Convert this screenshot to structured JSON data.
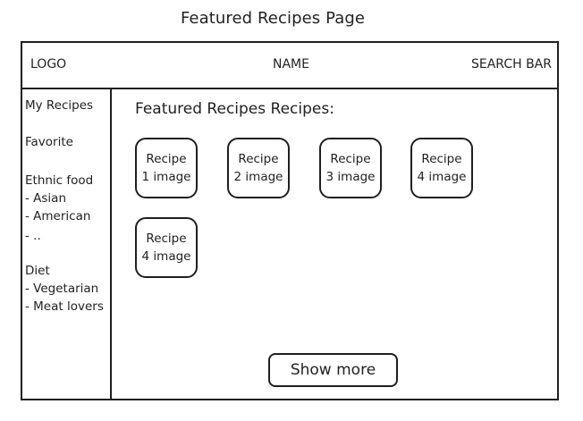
{
  "page_caption": "Featured Recipes Page",
  "header": {
    "logo": "LOGO",
    "name": "NAME",
    "search": "SEARCH BAR"
  },
  "sidebar": {
    "items": [
      "My Recipes",
      "Favorite",
      "Ethnic food",
      "- Asian",
      "- American",
      "- ..",
      "Diet",
      "- Vegetarian",
      "- Meat lovers"
    ]
  },
  "main": {
    "title": "Featured Recipes Recipes:",
    "cards": [
      {
        "line1": "Recipe",
        "line2": "1 image"
      },
      {
        "line1": "Recipe",
        "line2": "2 image"
      },
      {
        "line1": "Recipe",
        "line2": "3 image"
      },
      {
        "line1": "Recipe",
        "line2": "4 image"
      },
      {
        "line1": "Recipe",
        "line2": "4 image"
      }
    ],
    "show_more": "Show more"
  }
}
